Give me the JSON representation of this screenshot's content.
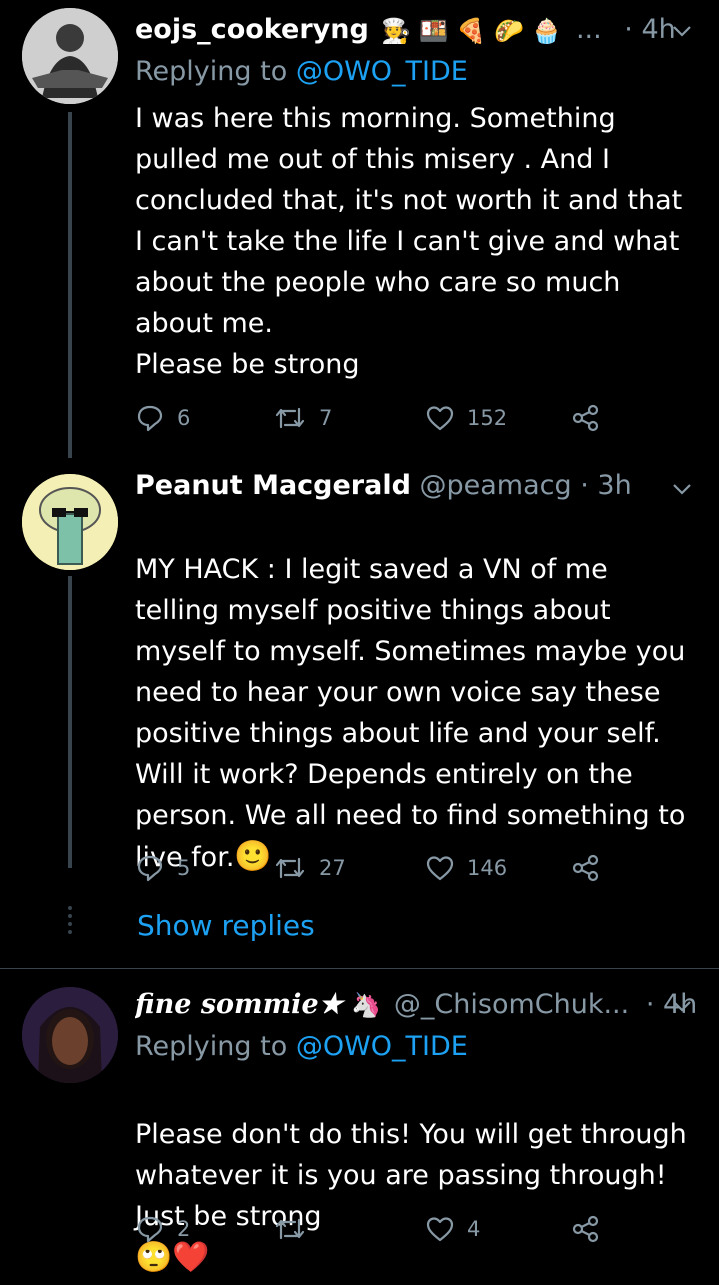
{
  "tweets": [
    {
      "display_name": "eojs_cookeryng",
      "name_emojis": "🧑‍🍳 🍱 🍕 🌮 🧁",
      "ellipsis": "...",
      "handle": "",
      "time": "· 4h",
      "replying_label": "Replying to",
      "replying_to": "@OWO_TIDE",
      "text": "I was here this morning. Something\npulled me out of this misery . And I\nconcluded that, it's not worth it and that\nI can't take the life I can't give and what\nabout the people who care so much\nabout me.\nPlease be strong",
      "replies": "6",
      "retweets": "7",
      "likes": "152"
    },
    {
      "display_name": "Peanut Macgerald",
      "handle": "@peamacg",
      "time": "· 3h",
      "text": "MY HACK : I legit saved a VN of me\ntelling myself positive things about\nmyself to myself. Sometimes maybe you\nneed to hear your own voice say these\npositive things about life and your self.\nWill it work? Depends entirely on the\nperson. We all need to find something to\nlive for.",
      "text_emoji": "🙂",
      "replies": "5",
      "retweets": "27",
      "likes": "146",
      "show_replies": "Show replies"
    },
    {
      "display_name": "fine sommie★",
      "name_emoji": "🦄",
      "handle": "@_ChisomChuk...",
      "time": "· 4h",
      "replying_label": "Replying to",
      "replying_to": "@OWO_TIDE",
      "text": "Please don't do this! You will get through\nwhatever it is you are passing through!\nJust be strong",
      "text_emojis": "🙄❤️",
      "replies": "2",
      "retweets": "",
      "likes": "4"
    }
  ],
  "colors": {
    "background": "#000000",
    "text": "#ffffff",
    "muted": "#8899a6",
    "accent": "#1da1f2",
    "line": "#38444d"
  },
  "icons": [
    "reply-icon",
    "retweet-icon",
    "like-icon",
    "share-icon",
    "chevron-down-icon"
  ]
}
